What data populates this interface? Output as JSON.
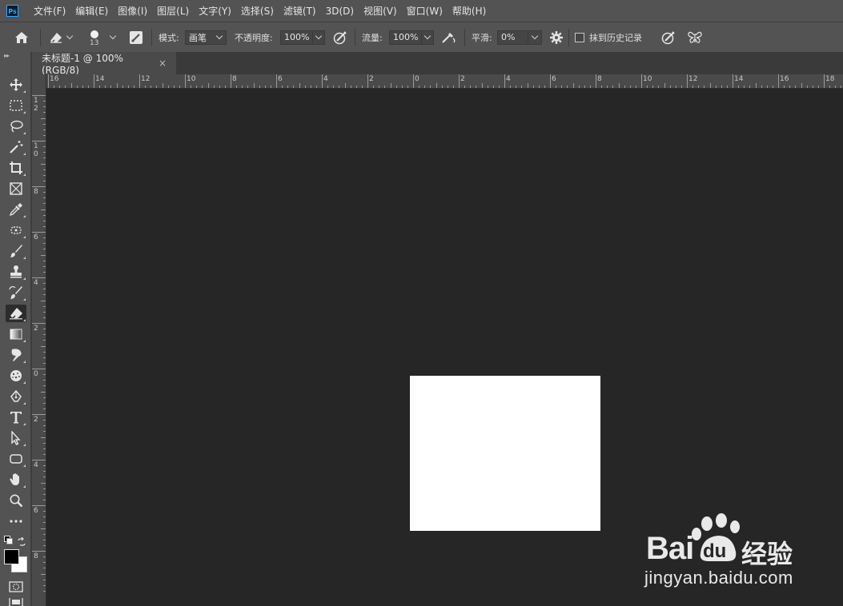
{
  "app": {
    "logo_text": "Ps"
  },
  "menu": {
    "items": [
      "文件(F)",
      "编辑(E)",
      "图像(I)",
      "图层(L)",
      "文字(Y)",
      "选择(S)",
      "滤镜(T)",
      "3D(D)",
      "视图(V)",
      "窗口(W)",
      "帮助(H)"
    ]
  },
  "options": {
    "brush_size": "13",
    "mode_label": "模式:",
    "mode_value": "画笔",
    "opacity_label": "不透明度:",
    "opacity_value": "100%",
    "flow_label": "流量:",
    "flow_value": "100%",
    "smoothing_label": "平滑:",
    "smoothing_value": "0%",
    "erase_history_label": "抹到历史记录",
    "erase_history_checked": false
  },
  "document": {
    "tab_title": "未标题-1 @ 100%(RGB/8)",
    "close_glyph": "×",
    "canvas_color": "#ffffff"
  },
  "rulers": {
    "horizontal_labels": [
      "16",
      "14",
      "12",
      "10",
      "8",
      "6",
      "4",
      "2",
      "0",
      "2",
      "4",
      "6",
      "8",
      "10",
      "12",
      "14",
      "16",
      "18"
    ],
    "vertical_labels": [
      "1 2",
      "1 0",
      "8",
      "6",
      "4",
      "2",
      "0",
      "2",
      "4",
      "6",
      "8"
    ]
  },
  "tools": [
    "move-tool",
    "rectangular-marquee-tool",
    "lasso-tool",
    "magic-wand-tool",
    "crop-tool",
    "frame-tool",
    "eyedropper-tool",
    "spot-healing-tool",
    "brush-tool",
    "clone-stamp-tool",
    "history-brush-tool",
    "eraser-tool",
    "gradient-tool",
    "smudge-tool",
    "sponge-tool",
    "pen-tool",
    "type-tool",
    "path-selection-tool",
    "rounded-rectangle-tool",
    "hand-tool",
    "zoom-tool",
    "more-tools"
  ],
  "colors": {
    "foreground": "#000000",
    "background": "#ffffff",
    "ui_panel": "#535353",
    "workspace": "#262626"
  },
  "watermark": {
    "brand_latin": "Bai",
    "brand_du": "du",
    "brand_cn": "经验",
    "url": "jingyan.baidu.com"
  }
}
